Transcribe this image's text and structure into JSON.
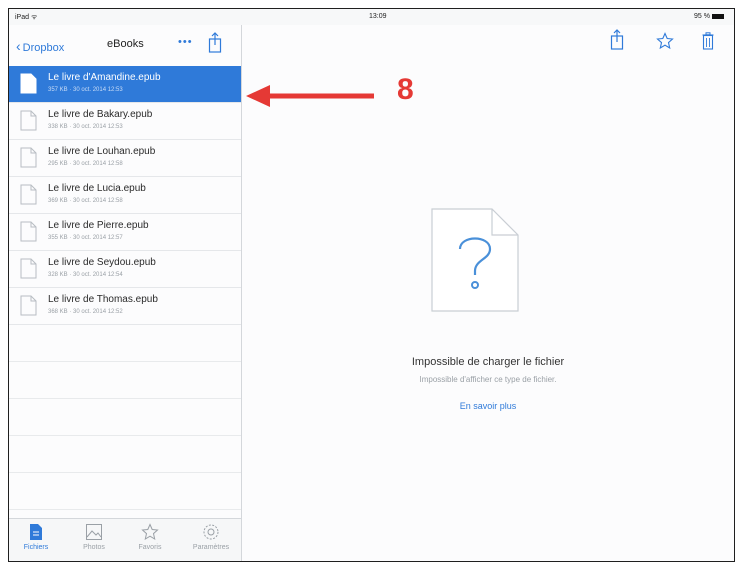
{
  "status": {
    "device": "iPad ᯤ",
    "time": "13:09",
    "battery": "95 %"
  },
  "nav": {
    "back_label": "Dropbox",
    "title": "eBooks",
    "more": "•••"
  },
  "files": [
    {
      "name": "Le livre d'Amandine.epub",
      "meta": "357 KB · 30 oct. 2014 12:53",
      "selected": true
    },
    {
      "name": "Le livre de Bakary.epub",
      "meta": "338 KB · 30 oct. 2014 12:53"
    },
    {
      "name": "Le livre de Louhan.epub",
      "meta": "295 KB · 30 oct. 2014 12:58"
    },
    {
      "name": "Le livre de Lucia.epub",
      "meta": "369 KB · 30 oct. 2014 12:58"
    },
    {
      "name": "Le livre de Pierre.epub",
      "meta": "355 KB · 30 oct. 2014 12:57"
    },
    {
      "name": "Le livre de Seydou.epub",
      "meta": "328 KB · 30 oct. 2014 12:54"
    },
    {
      "name": "Le livre de Thomas.epub",
      "meta": "368 KB · 30 oct. 2014 12:52"
    }
  ],
  "tabs": [
    {
      "label": "Fichiers",
      "icon": "document-icon",
      "active": true
    },
    {
      "label": "Photos",
      "icon": "photos-icon"
    },
    {
      "label": "Favoris",
      "icon": "star-icon"
    },
    {
      "label": "Paramètres",
      "icon": "gear-icon"
    }
  ],
  "detail": {
    "error_title": "Impossible de charger le fichier",
    "error_sub": "Impossible d'afficher ce type de fichier.",
    "link": "En savoir plus"
  },
  "annotation": {
    "number": "8",
    "color": "#e53935"
  },
  "colors": {
    "accent": "#2f7ad9"
  }
}
